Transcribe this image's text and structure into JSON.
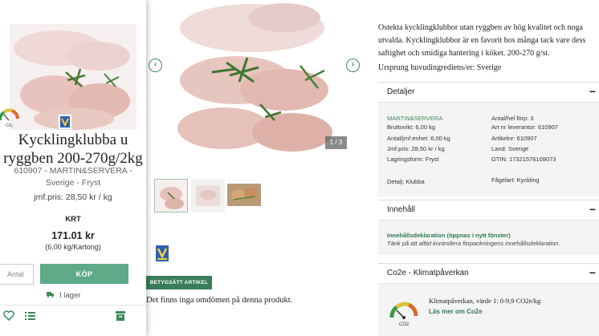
{
  "card": {
    "title": "Kycklingklubba u ryggben 200-270g/2kg",
    "subtitle": "610907 - MARTIN&SERVERA - Sverige - Fryst",
    "jmf_price": "jmf.pris: 28,50 kr / kg",
    "currency": "KRT",
    "price": "171.01 kr",
    "unit_price": "(6,00 kg/Kartong)",
    "qty_placeholder": "Antal",
    "buy_label": "KÖP",
    "stock_label": "I lager",
    "icons": [
      "climate-gauge-icon",
      "brand-logo-icon",
      "truck-icon",
      "heart-icon",
      "list-icon",
      "archive-icon"
    ],
    "buy_color": "#5eaa89"
  },
  "gallery": {
    "counter": "1 / 3",
    "rating_button": "BETYGSÄTT ARTIKEL",
    "no_reviews": "Det finns inga omdömen på denna produkt.",
    "thumb_count": 3
  },
  "panel": {
    "description": "Ostekta kycklingklubbor utan ryggben av hög kvalitet och noga utvalda. Kycklingklubbor är en favorit hos många tack vare dess saftighet och smidiga hantering i köket. 200-270 g/st.",
    "origin": "Ursprung huvudingrediens/er: Sverige",
    "details": {
      "header": "Detaljer",
      "brand": "MARTIN&SERVERA",
      "left": [
        "Bruttovikt: 6,00 kg",
        "Antal/jmf.enhet: 6,00 kg",
        "Jmf.pris: 28,50 kr / kg",
        "Lagringsform: Fryst"
      ],
      "right": [
        "Antal/hel förp: 3",
        "Art nr leverantor: 610907",
        "Artikelnr: 610907",
        "Land: Sverige",
        "GTIN: 17321576109073"
      ],
      "detail_label": "Detalj: Klubba",
      "fagelart": "Fågelart: Kyckling"
    },
    "contents": {
      "header": "Innehåll",
      "link": "Innehållsdeklaration (öppnas i nytt fönster)",
      "note": "Tänk på att alltid kontrollera förpackningens innehållsdeklaration."
    },
    "climate": {
      "header": "Co2e - Klimatpåverkan",
      "text": "Klimatpåverkan, värde 1: 0-9,9 CO2e/kg",
      "link": "Läs mer om Co2e",
      "gauge_label": "CO2"
    },
    "accent_color": "#3a8a5c"
  }
}
